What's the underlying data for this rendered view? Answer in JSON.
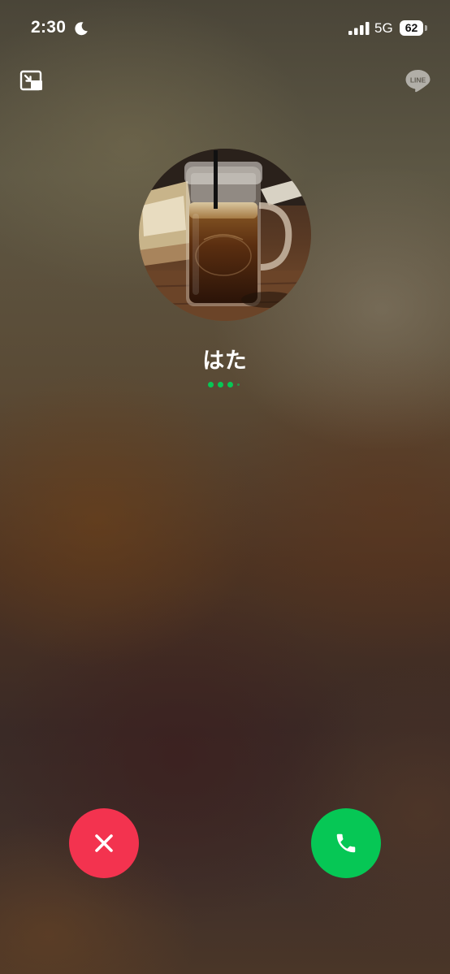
{
  "status_bar": {
    "time": "2:30",
    "network": "5G",
    "battery_level": "62",
    "focus_icon": "moon-icon",
    "signal_icon": "cellular-signal-icon"
  },
  "header": {
    "minimize_icon": "picture-in-picture-icon",
    "app_logo_text": "LINE"
  },
  "caller": {
    "name": "はた",
    "avatar_description_icon": "avatar-photo"
  },
  "status": {
    "calling_indicator": "dots",
    "indicator_color": "#06c755"
  },
  "actions": {
    "decline_icon": "close-icon",
    "decline_color": "#f3334f",
    "accept_icon": "phone-icon",
    "accept_color": "#06c755"
  }
}
